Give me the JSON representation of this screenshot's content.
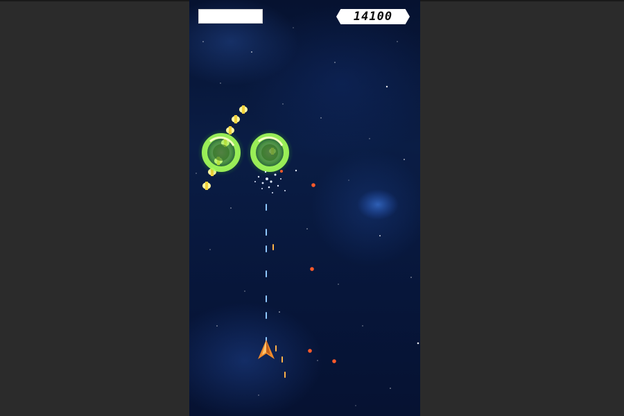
{
  "hud": {
    "score": "14100"
  }
}
